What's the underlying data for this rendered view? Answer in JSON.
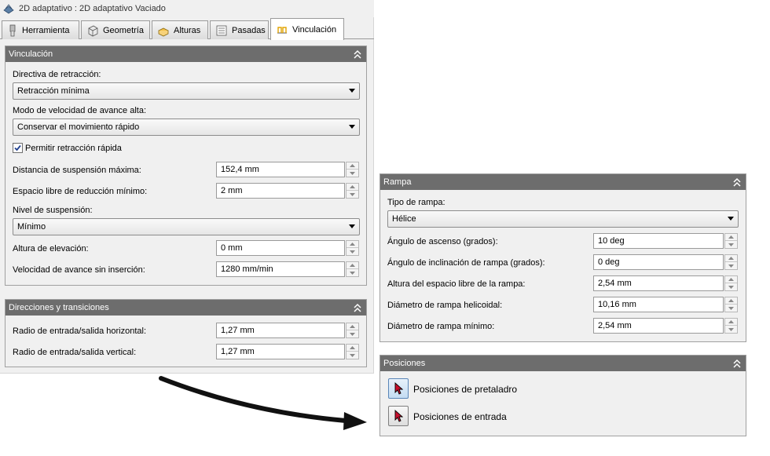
{
  "window": {
    "title": "2D adaptativo : 2D adaptativo  Vaciado"
  },
  "tabs": [
    {
      "label": "Herramienta"
    },
    {
      "label": "Geometría"
    },
    {
      "label": "Alturas"
    },
    {
      "label": "Pasadas"
    },
    {
      "label": "Vinculación"
    }
  ],
  "vinculacion": {
    "title": "Vinculación",
    "retract_policy_label": "Directiva de retracción:",
    "retract_policy_value": "Retracción mínima",
    "high_feed_label": "Modo de velocidad de avance alta:",
    "high_feed_value": "Conservar el movimiento rápido",
    "allow_rapid_retract_label": "Permitir retracción rápida",
    "allow_rapid_retract_checked": true,
    "max_stay_down_label": "Distancia de suspensión máxima:",
    "max_stay_down_value": "152,4 mm",
    "min_clearance_label": "Espacio libre de reducción mínimo:",
    "min_clearance_value": "2 mm",
    "stay_down_level_label": "Nivel de suspensión:",
    "stay_down_level_value": "Mínimo",
    "lift_height_label": "Altura de elevación:",
    "lift_height_value": "0 mm",
    "no_engage_feed_label": "Velocidad de avance sin inserción:",
    "no_engage_feed_value": "1280 mm/min"
  },
  "transitions": {
    "title": "Direcciones y transiciones",
    "horizontal_radius_label": "Radio de entrada/salida horizontal:",
    "horizontal_radius_value": "1,27 mm",
    "vertical_radius_label": "Radio de entrada/salida vertical:",
    "vertical_radius_value": "1,27 mm"
  },
  "rampa": {
    "title": "Rampa",
    "ramp_type_label": "Tipo de rampa:",
    "ramp_type_value": "Hélice",
    "ramp_angle_label": "Ángulo de ascenso (grados):",
    "ramp_angle_value": "10 deg",
    "ramp_taper_label": "Ángulo de inclinación de rampa (grados):",
    "ramp_taper_value": "0 deg",
    "ramp_clearance_label": "Altura del espacio libre de la rampa:",
    "ramp_clearance_value": "2,54 mm",
    "helical_diameter_label": "Diámetro de rampa helicoidal:",
    "helical_diameter_value": "10,16 mm",
    "min_ramp_diameter_label": "Diámetro de rampa mínimo:",
    "min_ramp_diameter_value": "2,54 mm"
  },
  "posiciones": {
    "title": "Posiciones",
    "predrill_label": "Posiciones de pretaladro",
    "entry_label": "Posiciones de entrada"
  },
  "colors": {
    "panel_header": "#6d6d6d",
    "arrow": "#111111",
    "pointer_red": "#c8102e"
  },
  "icons": {
    "collapse": "chevron-double-up-icon",
    "dropdown": "triangle-down-icon",
    "pointer": "cursor-pointer-icon"
  }
}
